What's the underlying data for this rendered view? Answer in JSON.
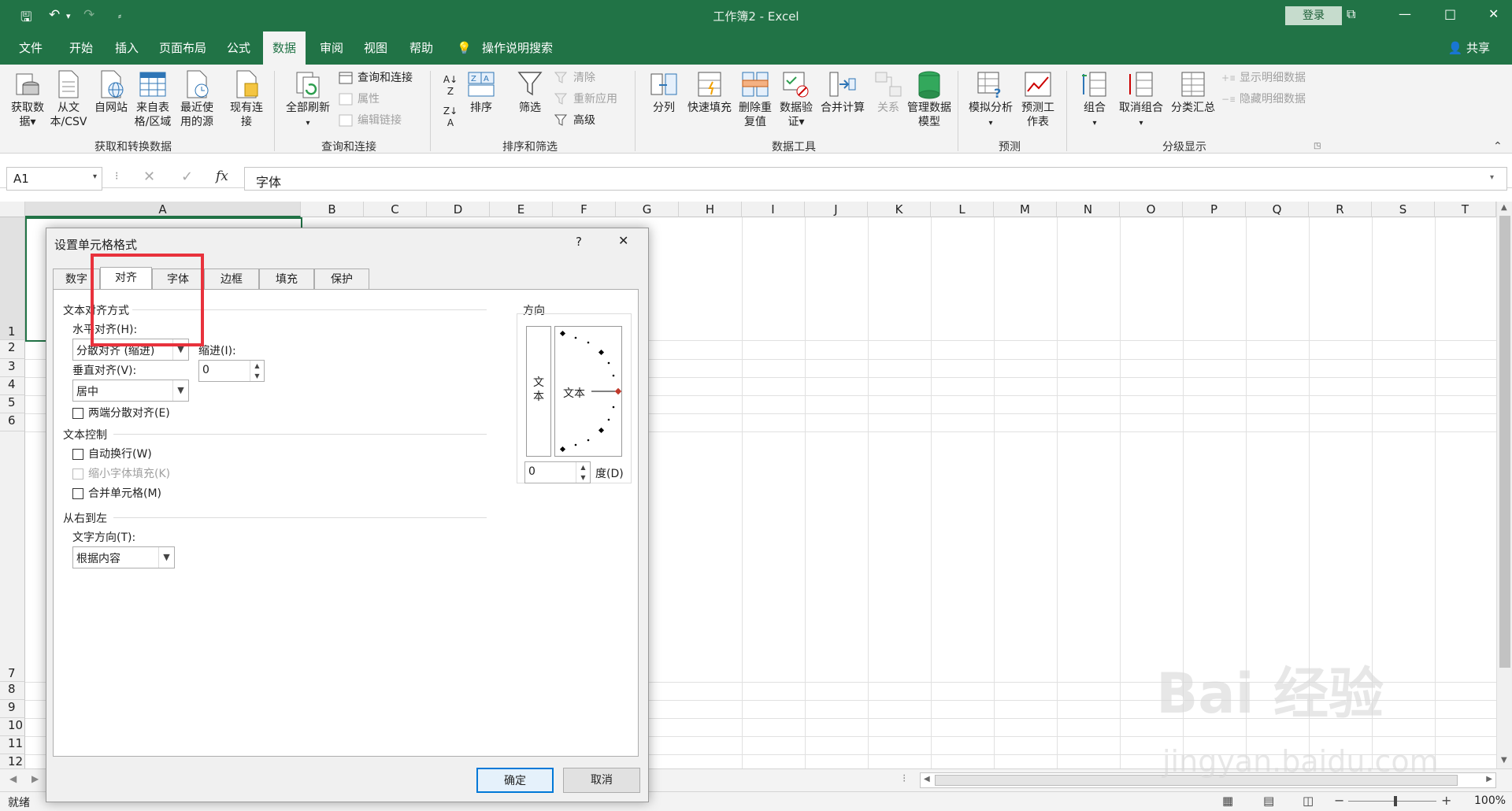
{
  "window": {
    "title": "工作簿2  -  Excel",
    "login": "登录",
    "minimize": "—",
    "restore": "□",
    "close": "✕",
    "ribbon_display": "⧉"
  },
  "quick_access": {
    "save": "🖫",
    "undo": "↶",
    "undo_arrow": "▾",
    "redo": "↷",
    "customize": "⸗"
  },
  "tabs": [
    "文件",
    "开始",
    "插入",
    "页面布局",
    "公式",
    "数据",
    "审阅",
    "视图",
    "帮助"
  ],
  "active_tab": "数据",
  "tell_me": "操作说明搜索",
  "share": "共享",
  "ribbon": {
    "get_data": "获取数据▾",
    "from_text": "从文本/CSV",
    "from_web": "自网站",
    "from_table": "来自表格/区域",
    "recent_sources": "最近使用的源",
    "existing_conn": "现有连接",
    "group1": "获取和转换数据",
    "refresh_all": "全部刷新",
    "queries_conn": "查询和连接",
    "properties": "属性",
    "edit_links": "编辑链接",
    "group2": "查询和连接",
    "sort": "排序",
    "filter": "筛选",
    "clear": "清除",
    "reapply": "重新应用",
    "advanced": "高级",
    "group3": "排序和筛选",
    "text_to_cols": "分列",
    "flash_fill": "快速填充",
    "remove_dup": "删除重复值",
    "data_valid": "数据验证▾",
    "consolidate": "合并计算",
    "relationships": "关系",
    "manage_model": "管理数据模型",
    "group4": "数据工具",
    "what_if": "模拟分析",
    "forecast_sheet": "预测工作表",
    "group5": "预测",
    "group_btn": "组合",
    "ungroup": "取消组合",
    "subtotal": "分类汇总",
    "show_detail": "显示明细数据",
    "hide_detail": "隐藏明细数据",
    "group6": "分级显示"
  },
  "formula_bar": {
    "name_box": "A1",
    "cancel": "✕",
    "enter": "✓",
    "fx": "fx",
    "content": "字体"
  },
  "columns": [
    "A",
    "B",
    "C",
    "D",
    "E",
    "F",
    "G",
    "H",
    "I",
    "J",
    "K",
    "L",
    "M",
    "N",
    "O",
    "P",
    "Q",
    "R",
    "S",
    "T"
  ],
  "rows": [
    "1",
    "2",
    "3",
    "4",
    "5",
    "6",
    "7",
    "8",
    "9",
    "10",
    "11",
    "12"
  ],
  "status": {
    "ready": "就绪",
    "zoom": "100%",
    "minus": "−",
    "plus": "+"
  },
  "dialog": {
    "title": "设置单元格格式",
    "help": "?",
    "close": "✕",
    "tabs": [
      "数字",
      "对齐",
      "字体",
      "边框",
      "填充",
      "保护"
    ],
    "active_tab": "对齐",
    "text_alignment": "文本对齐方式",
    "horizontal_label": "水平对齐(H):",
    "horizontal_value": "分散对齐 (缩进)",
    "indent_label": "缩进(I):",
    "indent_value": "0",
    "vertical_label": "垂直对齐(V):",
    "vertical_value": "居中",
    "justify_distributed": "两端分散对齐(E)",
    "text_control": "文本控制",
    "wrap_text": "自动换行(W)",
    "shrink_fit": "缩小字体填充(K)",
    "merge_cells": "合并单元格(M)",
    "rtl": "从右到左",
    "text_direction_label": "文字方向(T):",
    "text_direction_value": "根据内容",
    "orientation": "方向",
    "vertical_text": "文本",
    "orient_text": "文本",
    "degrees_value": "0",
    "degrees_label": "度(D)",
    "ok": "确定",
    "cancel": "取消"
  },
  "watermark": {
    "brand": "Bai 经验",
    "url": "jingyan.baidu.com"
  }
}
